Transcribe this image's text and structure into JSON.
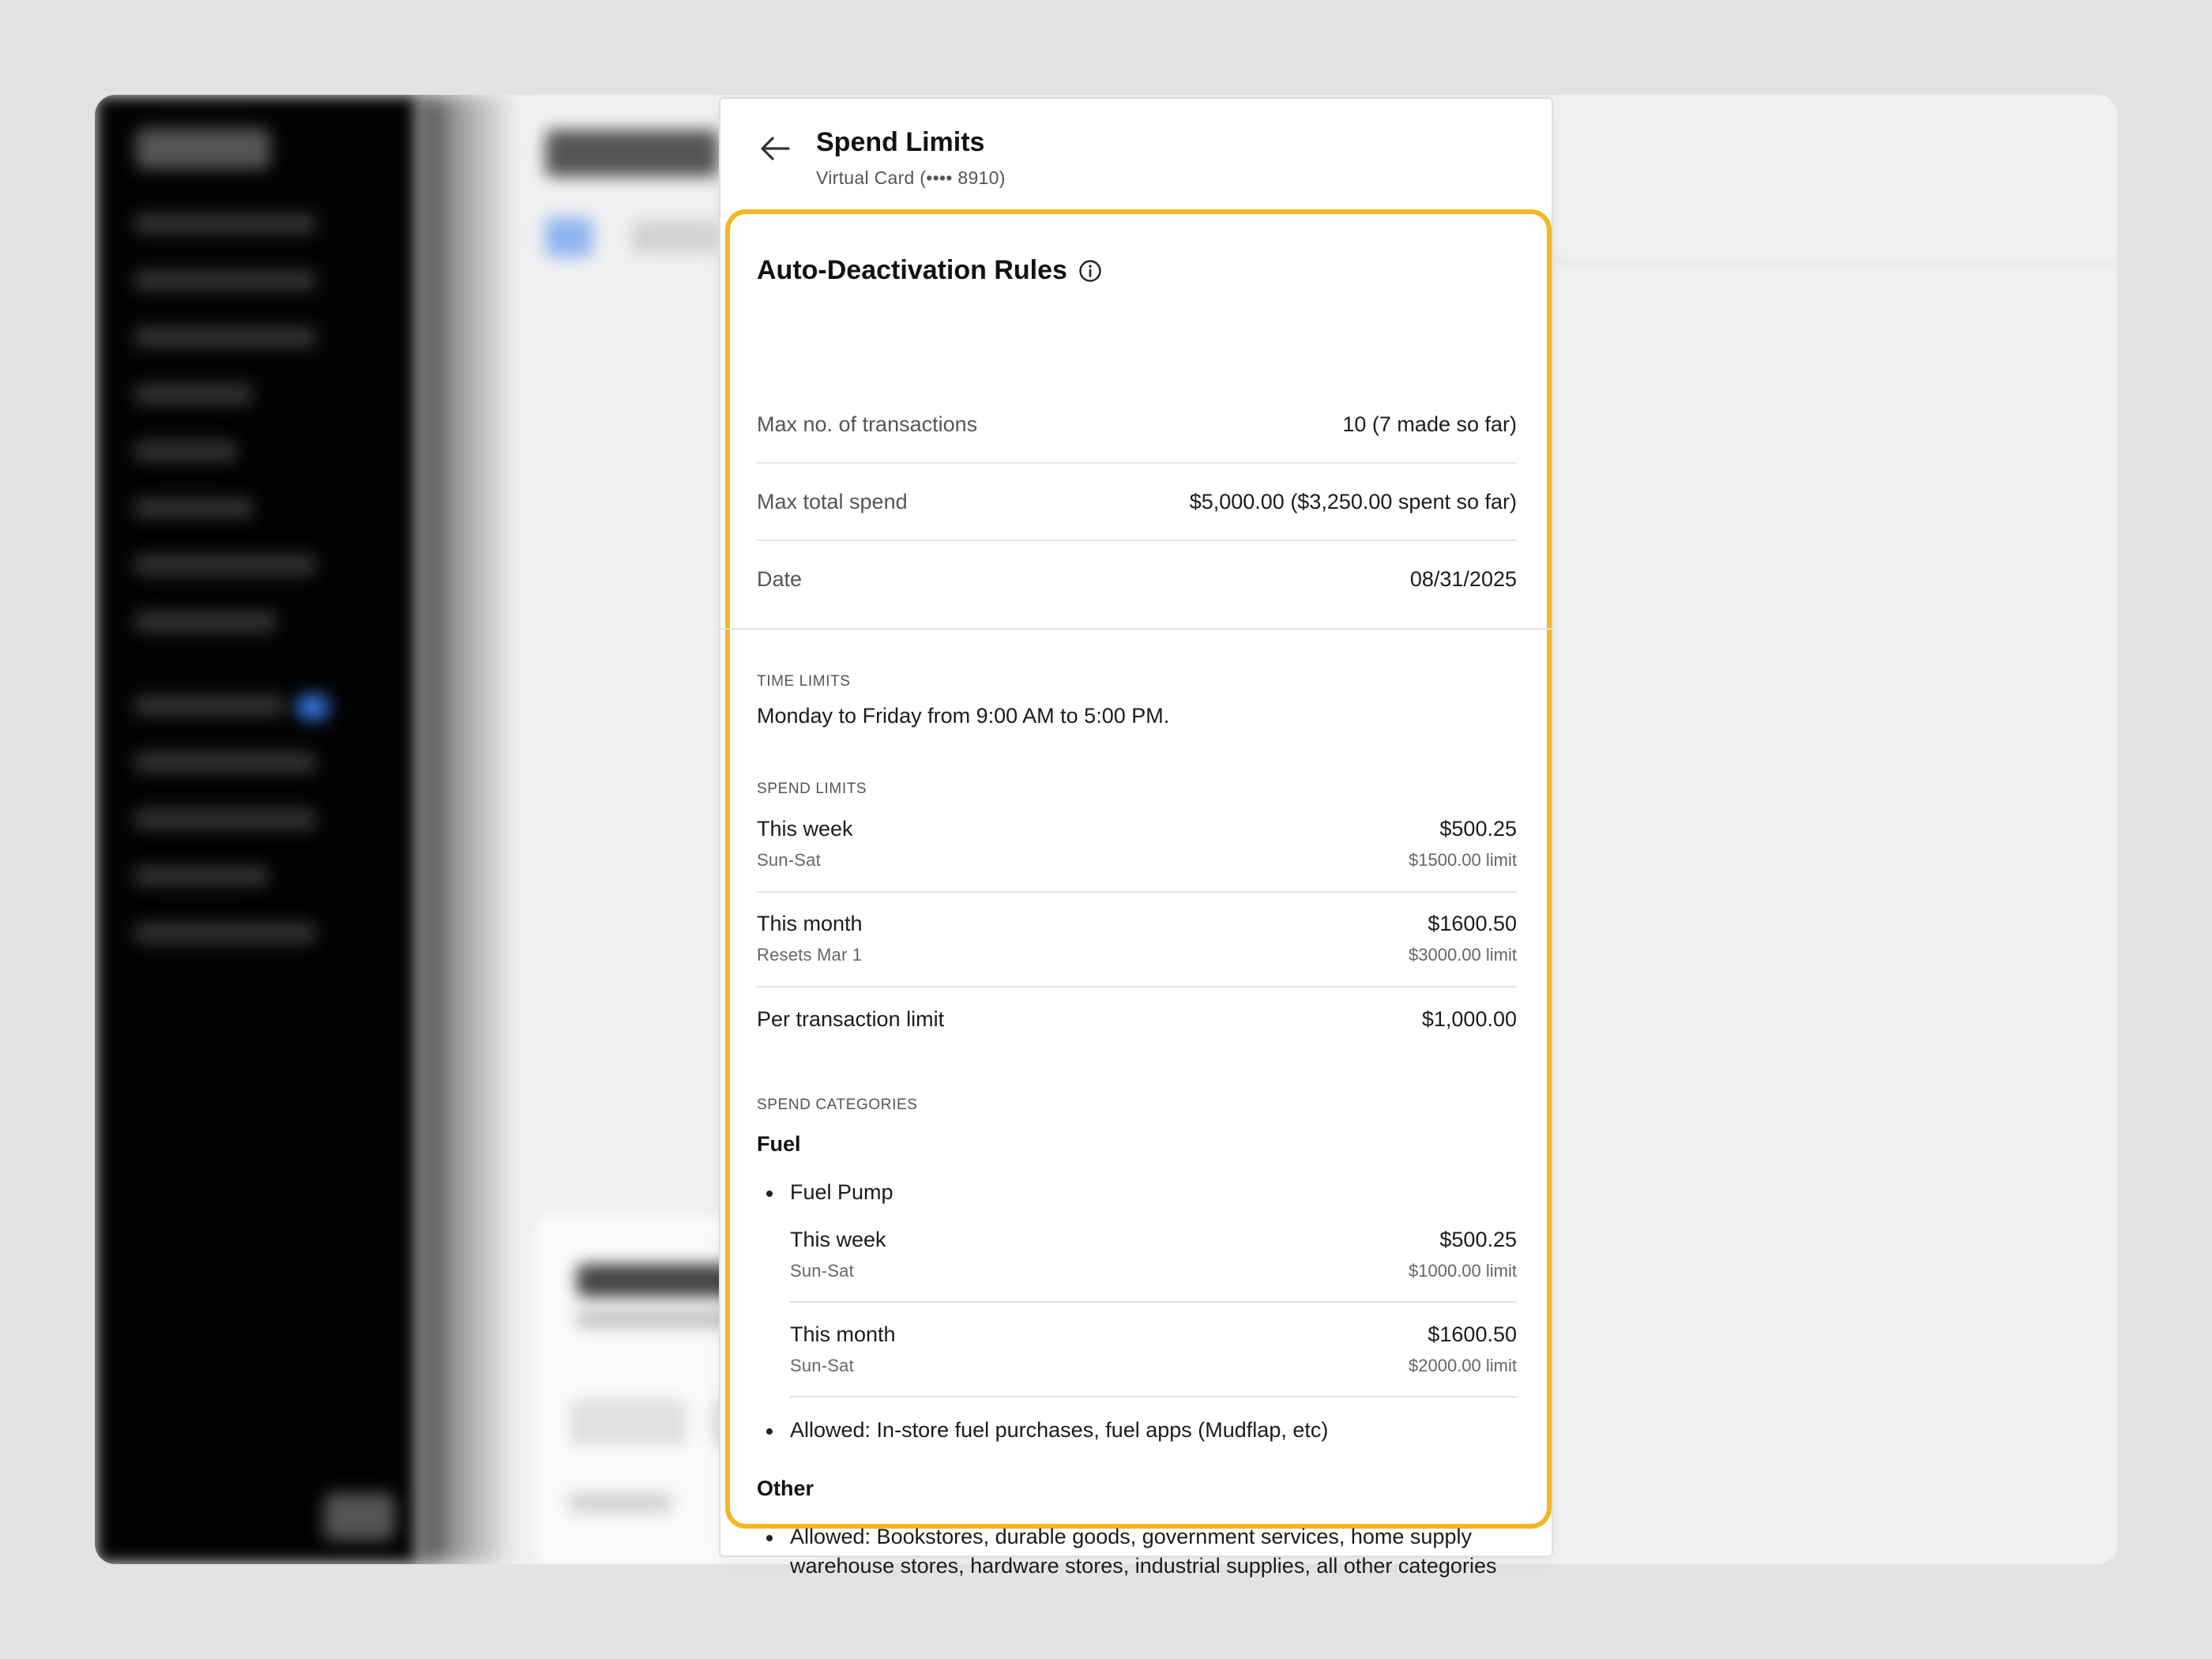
{
  "panel": {
    "title": "Spend Limits",
    "subtitle": "Virtual Card (•••• 8910)"
  },
  "auto_deactivation": {
    "title": "Auto-Deactivation Rules",
    "rows": [
      {
        "label": "Max no. of transactions",
        "value": "10 (7 made so far)"
      },
      {
        "label": "Max total spend",
        "value": "$5,000.00 ($3,250.00 spent so far)"
      },
      {
        "label": "Date",
        "value": "08/31/2025"
      }
    ]
  },
  "time_limits": {
    "caption": "TIME LIMITS",
    "text": "Monday to Friday from 9:00 AM to 5:00 PM."
  },
  "spend_limits": {
    "caption": "SPEND LIMITS",
    "rows": [
      {
        "name": "This week",
        "sub": "Sun-Sat",
        "amount": "$500.25",
        "limit": "$1500.00 limit"
      },
      {
        "name": "This month",
        "sub": "Resets Mar 1",
        "amount": "$1600.50",
        "limit": "$3000.00 limit"
      }
    ],
    "per_transaction": {
      "label": "Per transaction limit",
      "value": "$1,000.00"
    }
  },
  "spend_categories": {
    "caption": "SPEND CATEGORIES",
    "fuel": {
      "name": "Fuel",
      "item": "Fuel Pump",
      "rows": [
        {
          "name": "This week",
          "sub": "Sun-Sat",
          "amount": "$500.25",
          "limit": "$1000.00 limit"
        },
        {
          "name": "This month",
          "sub": "Sun-Sat",
          "amount": "$1600.50",
          "limit": "$2000.00 limit"
        }
      ],
      "allowed": "Allowed: In-store fuel purchases, fuel apps (Mudflap, etc)"
    },
    "other": {
      "name": "Other",
      "allowed": "Allowed: Bookstores, durable goods, government services, home supply warehouse stores, hardware stores, industrial supplies, all other categories"
    }
  },
  "colors": {
    "highlight": "#f5b623",
    "badge": "#2f6fd0"
  },
  "icons": [
    "arrow-left-icon",
    "info-icon"
  ]
}
